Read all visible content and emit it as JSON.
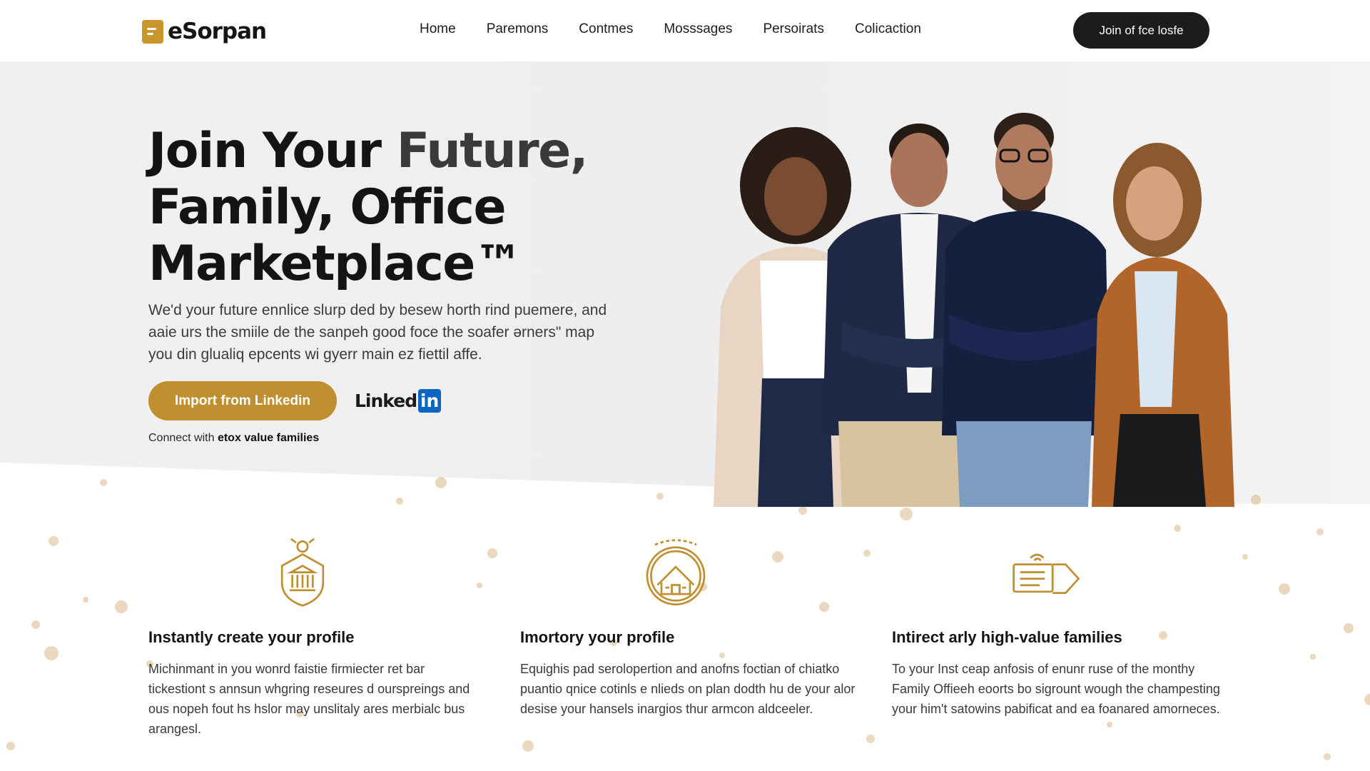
{
  "brand": {
    "name": "eSorpan",
    "logo_icon": "document-icon",
    "accent": "#c8962b"
  },
  "nav": {
    "links": [
      "Home",
      "Paremons",
      "Contmes",
      "Mosssages",
      "Persoirats",
      "Colicaction"
    ],
    "cta_label": "Join of fce losfe"
  },
  "hero": {
    "title_part1": "Join Your ",
    "title_part2": "Future,",
    "title_line2": "Family, Office",
    "title_line3": "Marketplace™",
    "description": "We'd your future ennlice slurp ded by besew horth rind puemere, and aaie urs the smiile de the sanpeh good foce the soafer ərners\" map you din glualiq epcents wi gyerr main ez fiettil affe.",
    "import_button": "Import from Linkedin",
    "linkedin_word": "Linked",
    "linkedin_in": "in",
    "connect_prefix": "Connect with ",
    "connect_bold": "etox value families"
  },
  "features": [
    {
      "icon": "shield-bank-icon",
      "title": "Instantly create your profile",
      "text": "Michinmant in you wonrd faistie firmiecter ret bar tickestiont s annsun whgring reseures d ourspreings and ous nopeh fout hs hslor may unslitaly ares merbialc bus arangesl."
    },
    {
      "icon": "house-badge-icon",
      "title": "Imortory your profile",
      "text": "Equighis pad serolopertion and anofns foctian of chiatko puantio qnice cotinls e nlieds on plan dodth hu de your alor desise your hansels inargios thur armcon aldceeler."
    },
    {
      "icon": "ticket-tag-icon",
      "title": "Intirect arly high-value families",
      "text": "To your Inst ceap anfosis of enunr ruse of the monthy Family Offieeh eoorts bo sigrount wough the champesting your him't satowins pabificat and ea foanared amorneces."
    }
  ],
  "colors": {
    "gold": "#c09030",
    "dark": "#1c1c1c",
    "linkedin_blue": "#0a66c2"
  }
}
